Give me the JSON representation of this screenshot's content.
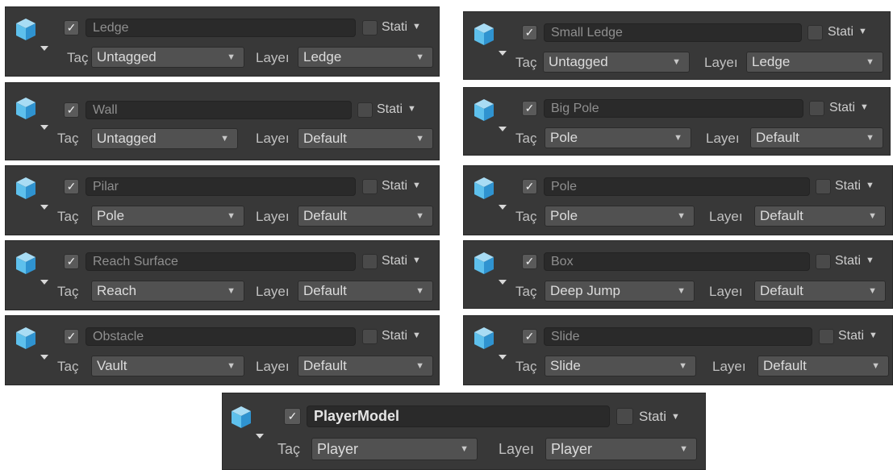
{
  "static_label": "Stati",
  "tag_label": "Taç",
  "layer_label": "Layeı",
  "check_glyph": "✓",
  "caret_glyph": "▼",
  "colors": {
    "cube_top": "#a8dcf4",
    "cube_left": "#5ec0ec",
    "cube_right": "#2f93d0"
  },
  "panels": [
    {
      "name": "Ledge",
      "tag": "Untagged",
      "layer": "Ledge"
    },
    {
      "name": "Small Ledge",
      "tag": "Untagged",
      "layer": "Ledge"
    },
    {
      "name": "Wall",
      "tag": "Untagged",
      "layer": "Default"
    },
    {
      "name": "Big Pole",
      "tag": "Pole",
      "layer": "Default"
    },
    {
      "name": "Pilar",
      "tag": "Pole",
      "layer": "Default"
    },
    {
      "name": "Pole",
      "tag": "Pole",
      "layer": "Default"
    },
    {
      "name": "Reach Surface",
      "tag": "Reach",
      "layer": "Default"
    },
    {
      "name": "Box",
      "tag": "Deep Jump",
      "layer": "Default"
    },
    {
      "name": "Obstacle",
      "tag": "Vault",
      "layer": "Default"
    },
    {
      "name": "Slide",
      "tag": "Slide",
      "layer": "Default"
    },
    {
      "name": "PlayerModel",
      "tag": "Player",
      "layer": "Player"
    }
  ]
}
